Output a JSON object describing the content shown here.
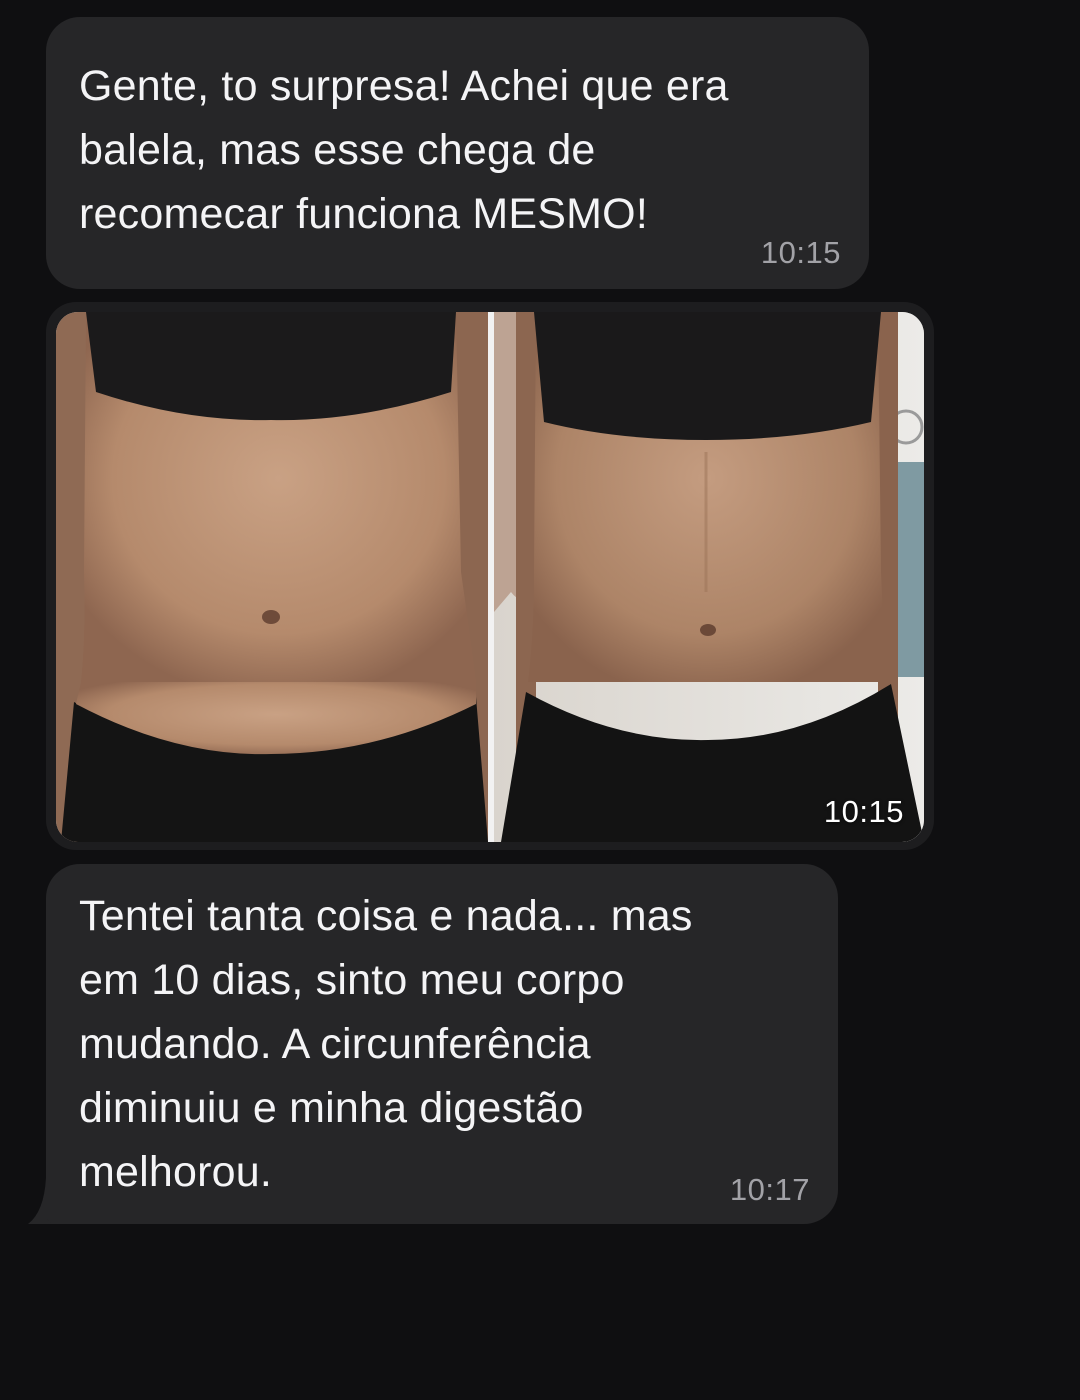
{
  "messages": [
    {
      "text": "Gente, to surpresa! Achei que era\nbalela, mas esse chega de\nrecomecar funciona MESMO!",
      "time": "10:15"
    },
    {
      "image": "before-after-abdomen-photo",
      "time": "10:15"
    },
    {
      "text": "Tentei tanta coisa e nada... mas\nem 10 dias, sinto meu corpo\nmudando. A circunferência\ndiminuiu e minha digestão\nmelhorou.",
      "time": "10:17"
    }
  ],
  "colors": {
    "background": "#0f0f11",
    "bubble": "#262628",
    "text": "#f4f4f6",
    "timestamp": "#a2a2a7"
  }
}
